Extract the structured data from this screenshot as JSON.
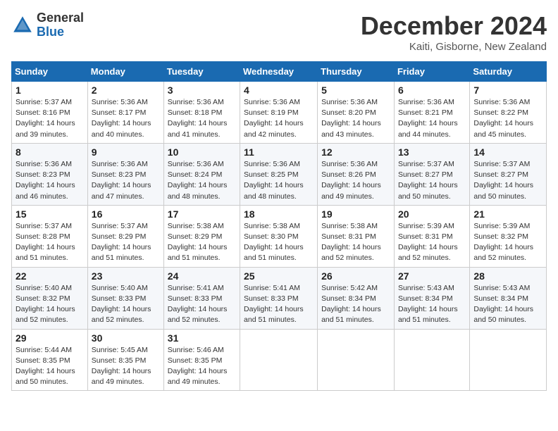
{
  "logo": {
    "general": "General",
    "blue": "Blue"
  },
  "title": {
    "month": "December 2024",
    "location": "Kaiti, Gisborne, New Zealand"
  },
  "weekdays": [
    "Sunday",
    "Monday",
    "Tuesday",
    "Wednesday",
    "Thursday",
    "Friday",
    "Saturday"
  ],
  "weeks": [
    [
      {
        "day": "1",
        "info": "Sunrise: 5:37 AM\nSunset: 8:16 PM\nDaylight: 14 hours\nand 39 minutes."
      },
      {
        "day": "2",
        "info": "Sunrise: 5:36 AM\nSunset: 8:17 PM\nDaylight: 14 hours\nand 40 minutes."
      },
      {
        "day": "3",
        "info": "Sunrise: 5:36 AM\nSunset: 8:18 PM\nDaylight: 14 hours\nand 41 minutes."
      },
      {
        "day": "4",
        "info": "Sunrise: 5:36 AM\nSunset: 8:19 PM\nDaylight: 14 hours\nand 42 minutes."
      },
      {
        "day": "5",
        "info": "Sunrise: 5:36 AM\nSunset: 8:20 PM\nDaylight: 14 hours\nand 43 minutes."
      },
      {
        "day": "6",
        "info": "Sunrise: 5:36 AM\nSunset: 8:21 PM\nDaylight: 14 hours\nand 44 minutes."
      },
      {
        "day": "7",
        "info": "Sunrise: 5:36 AM\nSunset: 8:22 PM\nDaylight: 14 hours\nand 45 minutes."
      }
    ],
    [
      {
        "day": "8",
        "info": "Sunrise: 5:36 AM\nSunset: 8:23 PM\nDaylight: 14 hours\nand 46 minutes."
      },
      {
        "day": "9",
        "info": "Sunrise: 5:36 AM\nSunset: 8:23 PM\nDaylight: 14 hours\nand 47 minutes."
      },
      {
        "day": "10",
        "info": "Sunrise: 5:36 AM\nSunset: 8:24 PM\nDaylight: 14 hours\nand 48 minutes."
      },
      {
        "day": "11",
        "info": "Sunrise: 5:36 AM\nSunset: 8:25 PM\nDaylight: 14 hours\nand 48 minutes."
      },
      {
        "day": "12",
        "info": "Sunrise: 5:36 AM\nSunset: 8:26 PM\nDaylight: 14 hours\nand 49 minutes."
      },
      {
        "day": "13",
        "info": "Sunrise: 5:37 AM\nSunset: 8:27 PM\nDaylight: 14 hours\nand 50 minutes."
      },
      {
        "day": "14",
        "info": "Sunrise: 5:37 AM\nSunset: 8:27 PM\nDaylight: 14 hours\nand 50 minutes."
      }
    ],
    [
      {
        "day": "15",
        "info": "Sunrise: 5:37 AM\nSunset: 8:28 PM\nDaylight: 14 hours\nand 51 minutes."
      },
      {
        "day": "16",
        "info": "Sunrise: 5:37 AM\nSunset: 8:29 PM\nDaylight: 14 hours\nand 51 minutes."
      },
      {
        "day": "17",
        "info": "Sunrise: 5:38 AM\nSunset: 8:29 PM\nDaylight: 14 hours\nand 51 minutes."
      },
      {
        "day": "18",
        "info": "Sunrise: 5:38 AM\nSunset: 8:30 PM\nDaylight: 14 hours\nand 51 minutes."
      },
      {
        "day": "19",
        "info": "Sunrise: 5:38 AM\nSunset: 8:31 PM\nDaylight: 14 hours\nand 52 minutes."
      },
      {
        "day": "20",
        "info": "Sunrise: 5:39 AM\nSunset: 8:31 PM\nDaylight: 14 hours\nand 52 minutes."
      },
      {
        "day": "21",
        "info": "Sunrise: 5:39 AM\nSunset: 8:32 PM\nDaylight: 14 hours\nand 52 minutes."
      }
    ],
    [
      {
        "day": "22",
        "info": "Sunrise: 5:40 AM\nSunset: 8:32 PM\nDaylight: 14 hours\nand 52 minutes."
      },
      {
        "day": "23",
        "info": "Sunrise: 5:40 AM\nSunset: 8:33 PM\nDaylight: 14 hours\nand 52 minutes."
      },
      {
        "day": "24",
        "info": "Sunrise: 5:41 AM\nSunset: 8:33 PM\nDaylight: 14 hours\nand 52 minutes."
      },
      {
        "day": "25",
        "info": "Sunrise: 5:41 AM\nSunset: 8:33 PM\nDaylight: 14 hours\nand 51 minutes."
      },
      {
        "day": "26",
        "info": "Sunrise: 5:42 AM\nSunset: 8:34 PM\nDaylight: 14 hours\nand 51 minutes."
      },
      {
        "day": "27",
        "info": "Sunrise: 5:43 AM\nSunset: 8:34 PM\nDaylight: 14 hours\nand 51 minutes."
      },
      {
        "day": "28",
        "info": "Sunrise: 5:43 AM\nSunset: 8:34 PM\nDaylight: 14 hours\nand 50 minutes."
      }
    ],
    [
      {
        "day": "29",
        "info": "Sunrise: 5:44 AM\nSunset: 8:35 PM\nDaylight: 14 hours\nand 50 minutes."
      },
      {
        "day": "30",
        "info": "Sunrise: 5:45 AM\nSunset: 8:35 PM\nDaylight: 14 hours\nand 49 minutes."
      },
      {
        "day": "31",
        "info": "Sunrise: 5:46 AM\nSunset: 8:35 PM\nDaylight: 14 hours\nand 49 minutes."
      },
      null,
      null,
      null,
      null
    ]
  ]
}
